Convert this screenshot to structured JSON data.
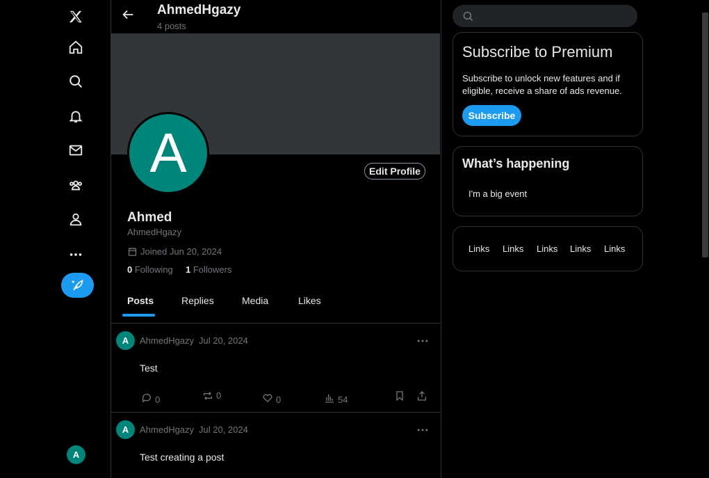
{
  "nav": {
    "items": [
      "x-logo-icon",
      "home-icon",
      "search-icon",
      "bell-icon",
      "mail-icon",
      "communities-icon",
      "profile-icon",
      "more-icon"
    ],
    "account_avatar_letter": "A"
  },
  "header": {
    "title": "AhmedHgazy",
    "subtitle": "4 posts"
  },
  "profile": {
    "avatar_letter": "A",
    "edit_label": "Edit Profile",
    "name": "Ahmed",
    "handle": "AhmedHgazy",
    "joined": "Joined Jun 20, 2024",
    "following_count": "0",
    "following_label": "Following",
    "followers_count": "1",
    "followers_label": "Followers"
  },
  "tabs": [
    {
      "label": "Posts",
      "active": true
    },
    {
      "label": "Replies"
    },
    {
      "label": "Media"
    },
    {
      "label": "Likes"
    }
  ],
  "posts": [
    {
      "avatar_letter": "A",
      "author": "AhmedHgazy",
      "date": "Jul 20, 2024",
      "text": "Test",
      "replies": "0",
      "reposts": "0",
      "likes": "0",
      "views": "54"
    },
    {
      "avatar_letter": "A",
      "author": "AhmedHgazy",
      "date": "Jul 20, 2024",
      "text": "Test creating a post"
    }
  ],
  "sidebar": {
    "search_placeholder": "",
    "premium": {
      "title": "Subscribe to Premium",
      "body": "Subscribe to unlock new features and if eligible, receive a share of ads revenue.",
      "button": "Subscribe"
    },
    "happening": {
      "title": "What’s happening",
      "item": "I'm a big event"
    },
    "links": [
      "Links",
      "Links",
      "Links",
      "Links",
      "Links"
    ]
  },
  "colors": {
    "accent": "#1d9bf0",
    "avatar": "#00857a",
    "banner": "#333639",
    "border": "#2f3336",
    "muted": "#71767b"
  }
}
